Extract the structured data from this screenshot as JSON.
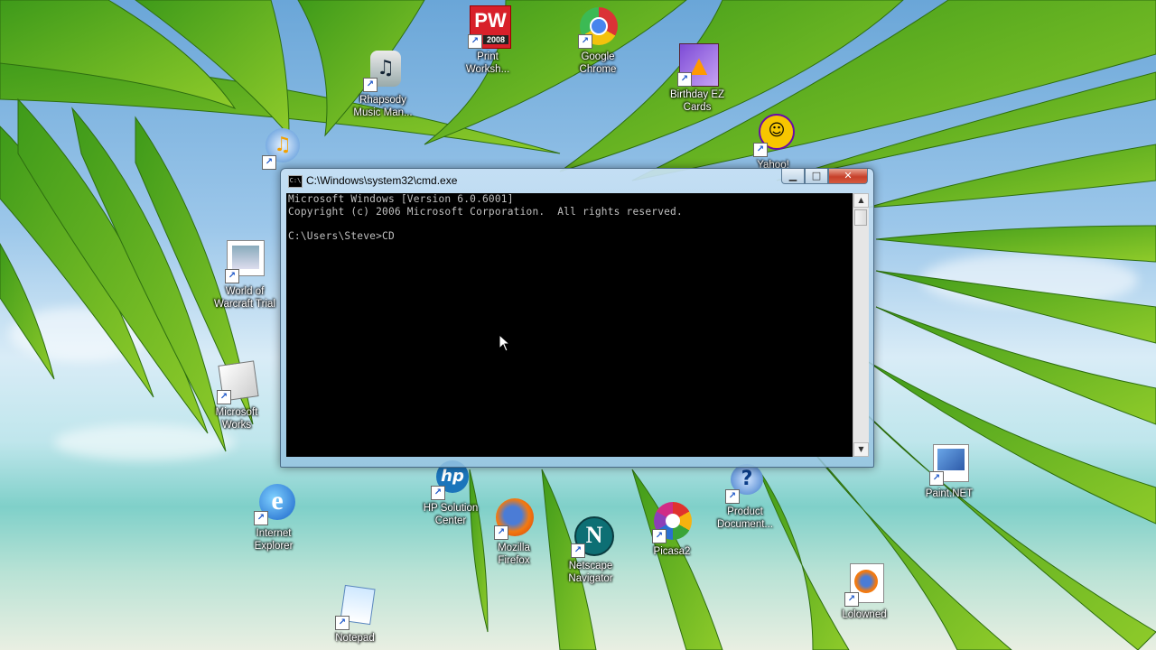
{
  "desktop": {
    "icons": [
      {
        "id": "print-workshop",
        "line1": "Print",
        "line2": "Worksh...",
        "badge": "PW",
        "sub": "2008"
      },
      {
        "id": "google-chrome",
        "line1": "Google",
        "line2": "Chrome"
      },
      {
        "id": "rhapsody",
        "line1": "Rhapsody",
        "line2": "Music Man..."
      },
      {
        "id": "birthday-ez-cards",
        "line1": "Birthday EZ",
        "line2": "Cards"
      },
      {
        "id": "yahoo",
        "line1": "Yahoo!",
        "line2": ""
      },
      {
        "id": "world-of-warcraft",
        "line1": "World of",
        "line2": "Warcraft Trial"
      },
      {
        "id": "microsoft-works",
        "line1": "Microsoft",
        "line2": "Works"
      },
      {
        "id": "internet-explorer",
        "line1": "Internet",
        "line2": "Explorer"
      },
      {
        "id": "hp-solution-center",
        "line1": "HP Solution",
        "line2": "Center",
        "badge": "hp"
      },
      {
        "id": "mozilla-firefox",
        "line1": "Mozilla",
        "line2": "Firefox"
      },
      {
        "id": "netscape-navigator",
        "line1": "Netscape",
        "line2": "Navigator",
        "badge": "N"
      },
      {
        "id": "picasa2",
        "line1": "Picasa2",
        "line2": ""
      },
      {
        "id": "product-documentation",
        "line1": "Product",
        "line2": "Document..."
      },
      {
        "id": "paint-net",
        "line1": "Paint.NET",
        "line2": ""
      },
      {
        "id": "lolowned",
        "line1": "Lolowned",
        "line2": ""
      },
      {
        "id": "notepad",
        "line1": "Notepad",
        "line2": ""
      }
    ]
  },
  "cmd": {
    "title": "C:\\Windows\\system32\\cmd.exe",
    "lines": [
      "Microsoft Windows [Version 6.0.6001]",
      "Copyright (c) 2006 Microsoft Corporation.  All rights reserved.",
      "",
      "C:\\Users\\Steve>CD"
    ]
  },
  "colors": {
    "console_bg": "#000000",
    "console_fg": "#c0c0c0",
    "close_red": "#c7402a"
  }
}
